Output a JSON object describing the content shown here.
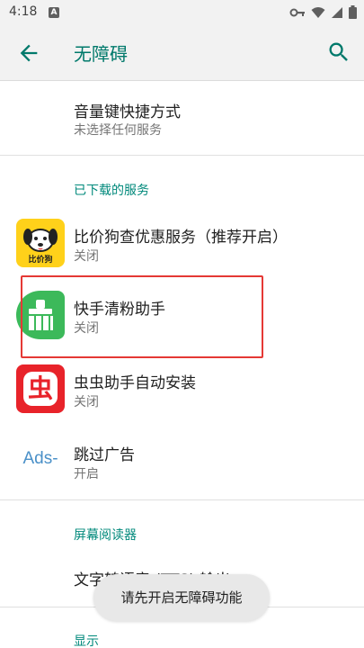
{
  "status_bar": {
    "time": "4:18",
    "notification_letter": "A",
    "icons": [
      "vpn-key-icon",
      "wifi-icon",
      "signal-icon",
      "battery-icon"
    ]
  },
  "app_bar": {
    "title": "无障碍",
    "back_icon": "arrow-back-icon",
    "search_icon": "search-icon",
    "accent_color": "#00796b"
  },
  "shortcut": {
    "title": "音量键快捷方式",
    "subtitle": "未选择任何服务"
  },
  "downloaded_section": {
    "header": "已下载的服务",
    "items": [
      {
        "title": "比价狗查优惠服务（推荐开启）",
        "status": "关闭",
        "icon": "bijiagou-app-icon",
        "icon_text": "比价狗"
      },
      {
        "title": "快手清粉助手",
        "status": "关闭",
        "icon": "broom-app-icon"
      },
      {
        "title": "虫虫助手自动安装",
        "status": "关闭",
        "icon": "chongchong-app-icon",
        "icon_text": "虫"
      },
      {
        "title": "跳过广告",
        "status": "开启",
        "icon": "ads-app-icon",
        "icon_text": "Ads-"
      }
    ]
  },
  "screen_reader_section": {
    "header": "屏幕阅读器",
    "items": [
      {
        "title": "文字转语音 (TTS) 输出"
      }
    ]
  },
  "display_section": {
    "header": "显示"
  },
  "toast": {
    "message": "请先开启无障碍功能"
  },
  "highlight_color": "#e53935"
}
